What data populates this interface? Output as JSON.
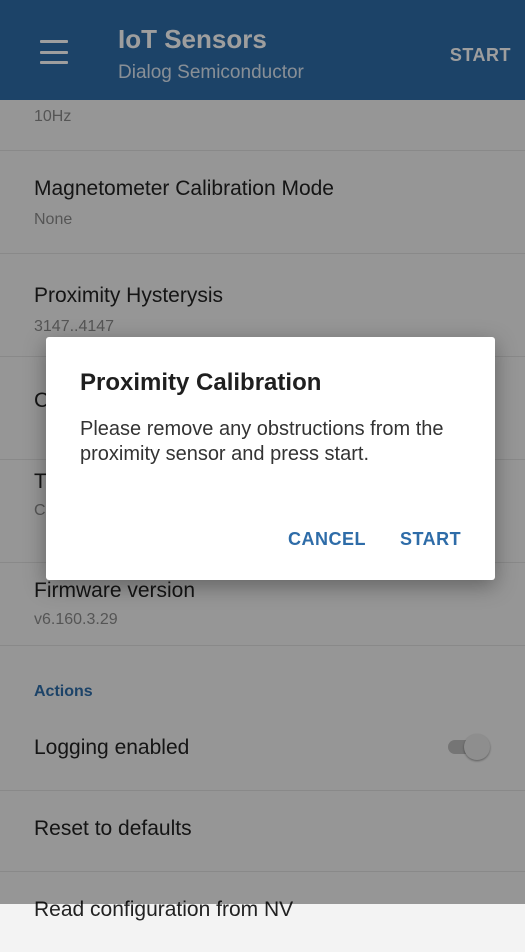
{
  "app_bar": {
    "title": "IoT Sensors",
    "subtitle": "Dialog Semiconductor",
    "action_label": "START",
    "color": "#2e6ca8"
  },
  "settings": {
    "top_value": "10Hz",
    "items": [
      {
        "title": "Magnetometer Calibration Mode",
        "value": "None"
      },
      {
        "title": "Proximity Hysterysis",
        "value": "3147..4147"
      },
      {
        "title": "C",
        "value": ""
      },
      {
        "title": "T",
        "value": "C"
      },
      {
        "title": "Firmware version",
        "value": "v6.160.3.29"
      }
    ],
    "section_actions": "Actions",
    "logging_label": "Logging enabled",
    "logging_enabled": false,
    "reset_label": "Reset to defaults",
    "read_label": "Read configuration from NV"
  },
  "dialog": {
    "title": "Proximity Calibration",
    "message": "Please remove any obstructions from the proximity sensor and press start.",
    "cancel_label": "CANCEL",
    "start_label": "START"
  },
  "icons": {
    "menu": "hamburger-menu-icon"
  }
}
